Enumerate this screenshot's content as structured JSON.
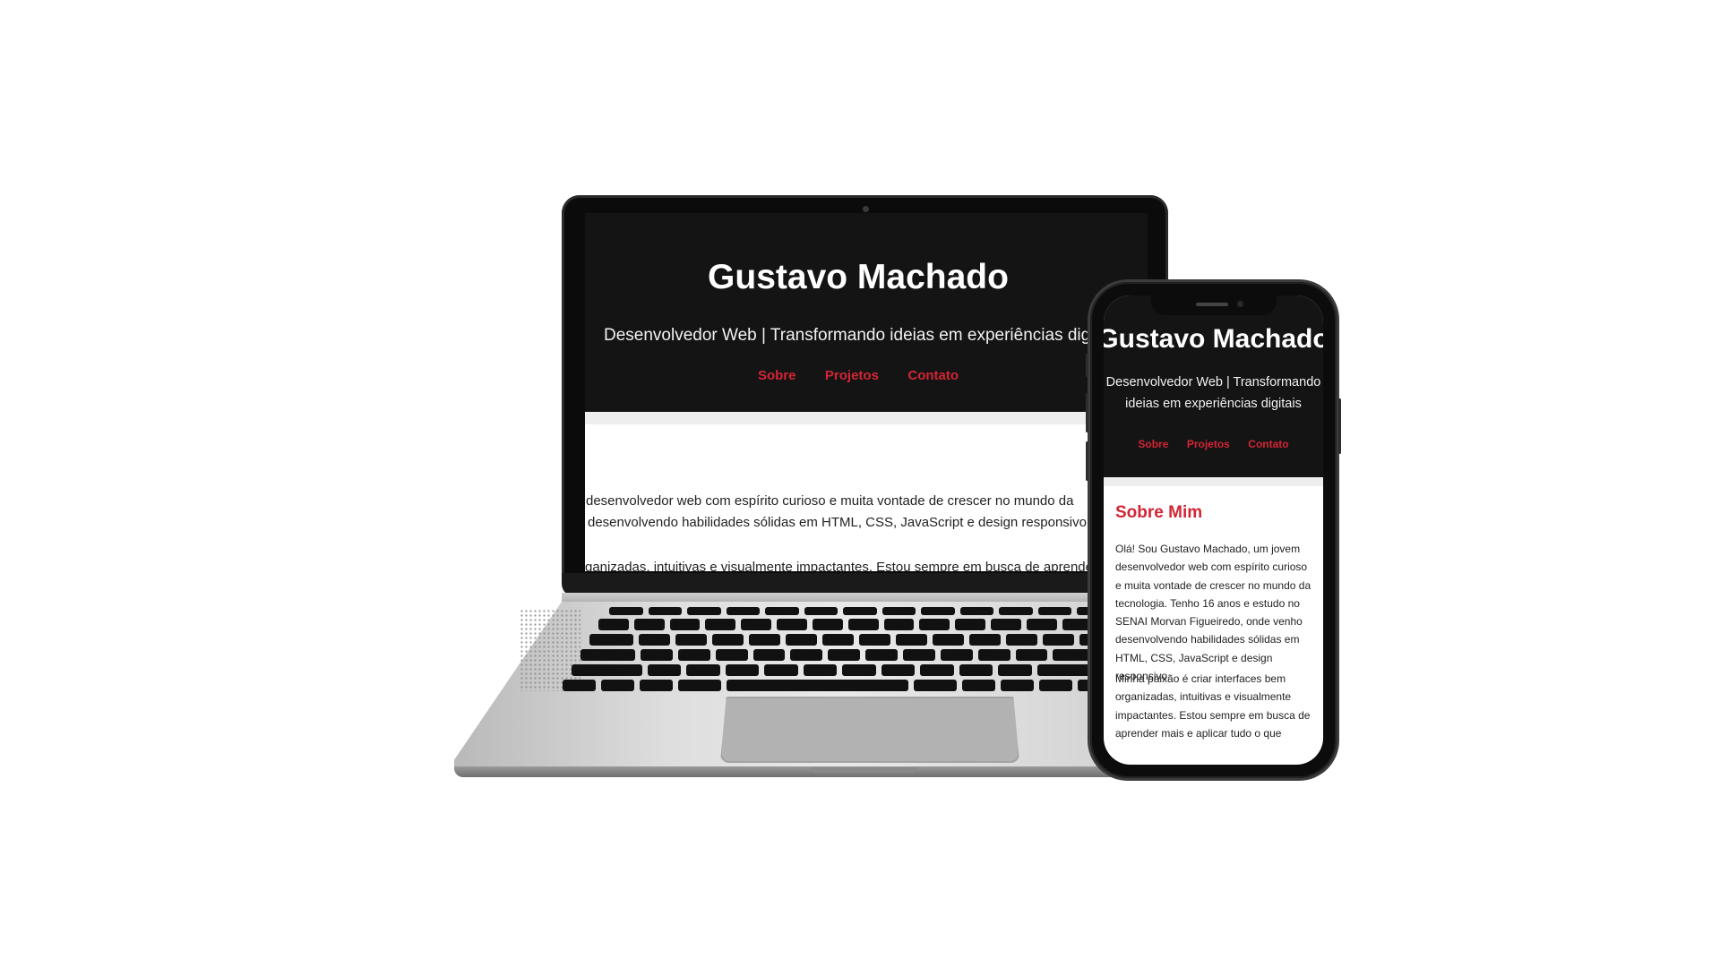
{
  "site": {
    "title": "Gustavo Machado",
    "subtitle": "Desenvolvedor Web | Transformando ideias em experiências digitais",
    "subtitle_laptop_visible": "Desenvolvedor Web | Transformando ideias em experiências digita",
    "subtitle_phone_line1": "Desenvolvedor Web | Transformando",
    "subtitle_phone_line2": "ideias em experiências digitais",
    "nav": [
      "Sobre",
      "Projetos",
      "Contato"
    ]
  },
  "laptop": {
    "body_lines": [
      "desenvolvedor web com espírito curioso e muita vontade de crescer no mundo da",
      "desenvolvendo habilidades sólidas em HTML, CSS, JavaScript e design responsivo.",
      "ganizadas, intuitivas e visualmente impactantes. Estou sempre em busca de aprende"
    ]
  },
  "about": {
    "heading": "Sobre Mim",
    "paragraph1": "Olá! Sou Gustavo Machado, um jovem desenvolvedor web com espírito curioso e muita vontade de crescer no mundo da tecnologia. Tenho 16 anos e estudo no SENAI Morvan Figueiredo, onde venho desenvolvendo habilidades sólidas em HTML, CSS, JavaScript e design responsivo.",
    "paragraph2": "Minha paixão é criar interfaces bem organizadas, intuitivas e visualmente impactantes. Estou sempre em busca de aprender mais e aplicar tudo o que"
  },
  "colors": {
    "header_bg": "#141414",
    "accent": "#d32535",
    "text": "#222222",
    "background": "#ffffff"
  }
}
